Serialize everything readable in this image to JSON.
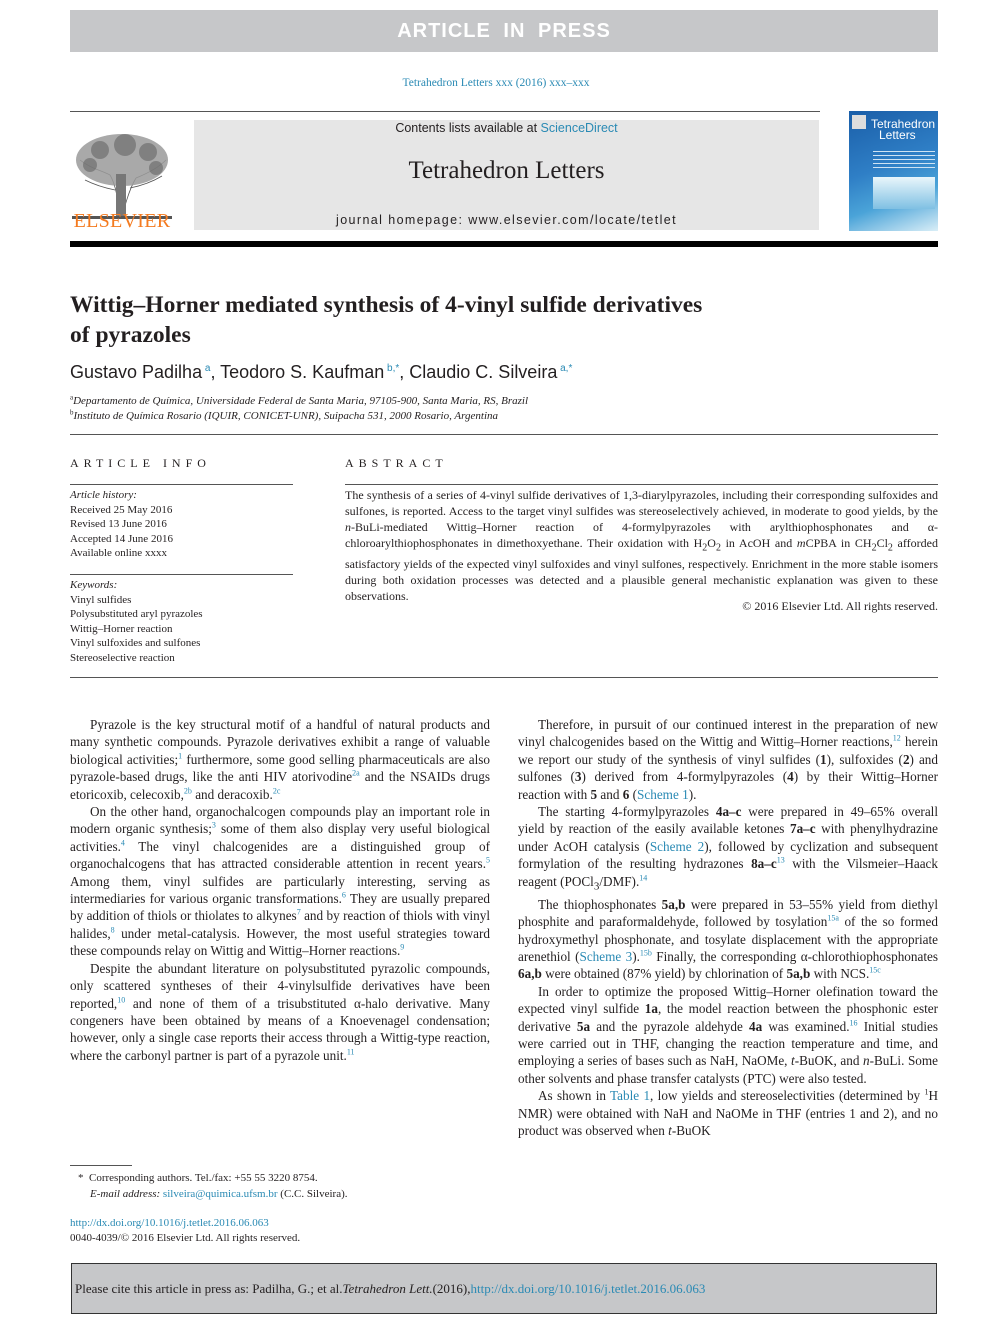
{
  "banner": {
    "label": "ARTICLE IN PRESS"
  },
  "citation_line": "Tetrahedron Letters xxx (2016) xxx–xxx",
  "header": {
    "publisher_logo_text": "ELSEVIER",
    "contents_prefix": "Contents lists available at ",
    "contents_link": "ScienceDirect",
    "journal_title": "Tetrahedron Letters",
    "homepage": "journal homepage: www.elsevier.com/locate/tetlet",
    "cover_title_1": "Tetrahedron",
    "cover_title_2": "Letters"
  },
  "article": {
    "title_line1": "Wittig–Horner mediated synthesis of 4-vinyl sulfide derivatives",
    "title_line2": "of pyrazoles",
    "authors": [
      {
        "name": "Gustavo Padilha",
        "sup": "a"
      },
      {
        "name": "Teodoro S. Kaufman",
        "sup": "b,*"
      },
      {
        "name": "Claudio C. Silveira",
        "sup": "a,*"
      }
    ],
    "affiliations": [
      {
        "mark": "a",
        "text": "Departamento de Química, Universidade Federal de Santa Maria, 97105-900, Santa Maria, RS, Brazil"
      },
      {
        "mark": "b",
        "text": "Instituto de Química Rosario (IQUIR, CONICET-UNR), Suipacha 531, 2000 Rosario, Argentina"
      }
    ]
  },
  "article_info": {
    "heading": "ARTICLE INFO",
    "history_label": "Article history:",
    "history": [
      "Received 25 May 2016",
      "Revised 13 June 2016",
      "Accepted 14 June 2016",
      "Available online xxxx"
    ],
    "keywords_label": "Keywords:",
    "keywords": [
      "Vinyl sulfides",
      "Polysubstituted aryl pyrazoles",
      "Wittig–Horner reaction",
      "Vinyl sulfoxides and sulfones",
      "Stereoselective reaction"
    ]
  },
  "abstract": {
    "heading": "ABSTRACT",
    "seg1": "The synthesis of a series of 4-vinyl sulfide derivatives of 1,3-diarylpyrazoles, including their corresponding sulfoxides and sulfones, is reported. Access to the target vinyl sulfides was stereoselectively achieved, in moderate to good yields, by the ",
    "seg_n": "n",
    "seg2": "-BuLi-mediated Wittig–Horner reaction of 4-formylpyrazoles with arylthiophosphonates and α-chloroarylthiophosphonates in dimethoxyethane. Their oxidation with H",
    "sub2": "2",
    "seg3": "O",
    "seg4": " in AcOH and ",
    "seg_m": "m",
    "seg5": "CPBA in CH",
    "seg6": "Cl",
    "seg7": " afforded satisfactory yields of the expected vinyl sulfoxides and vinyl sulfones, respectively. Enrichment in the more stable isomers during both oxidation processes was detected and a plausible general mechanistic explanation was given to these observations.",
    "copyright": "© 2016 Elsevier Ltd. All rights reserved."
  },
  "body_left": {
    "p1": [
      "Pyrazole is the key structural motif of a handful of natural products and many synthetic compounds. Pyrazole derivatives exhibit a range of valuable biological activities;",
      "1",
      " furthermore, some good selling pharmaceuticals are also pyrazole-based drugs, like the anti HIV atorivodine",
      "2a",
      " and the NSAIDs drugs etoricoxib, celecoxib,",
      "2b",
      " and deracoxib.",
      "2c"
    ],
    "p2": [
      "On the other hand, organochalcogen compounds play an important role in modern organic synthesis;",
      "3",
      " some of them also display very useful biological activities.",
      "4",
      " The vinyl chalcogenides are a distinguished group of organochalcogens that has attracted considerable attention in recent years.",
      "5",
      " Among them, vinyl sulfides are particularly interesting, serving as intermediaries for various organic transformations.",
      "6",
      " They are usually prepared by addition of thiols or thiolates to alkynes",
      "7",
      " and by reaction of thiols with vinyl halides,",
      "8",
      " under metal-catalysis. However, the most useful strategies toward these compounds relay on Wittig and Wittig–Horner reactions.",
      "9"
    ],
    "p3": [
      "Despite the abundant literature on polysubstituted pyrazolic compounds, only scattered syntheses of their 4-vinylsulfide derivatives have been reported,",
      "10",
      " and none of them of a trisubstituted α-halo derivative. Many congeners have been obtained by means of a Knoevenagel condensation; however, only a single case reports their access through a Wittig-type reaction, where the carbonyl partner is part of a pyrazole unit.",
      "11"
    ]
  },
  "body_right": {
    "p1": {
      "a": "Therefore, in pursuit of our continued interest in the preparation of new vinyl chalcogenides based on the Wittig and Wittig–Horner reactions,",
      "r12": "12",
      "b": " herein we report our study of the synthesis of vinyl sulfides (",
      "c1": "1",
      "c": "), sulfoxides (",
      "c2": "2",
      "d": ") and sulfones (",
      "c3": "3",
      "e": ") derived from 4-formylpyrazoles (",
      "c4": "4",
      "f": ") by their Wittig–Horner reaction with ",
      "c5": "5",
      "g": " and ",
      "c6": "6",
      "h": " (",
      "link": "Scheme 1",
      "i": ")."
    },
    "p2": {
      "a": "The starting 4-formylpyrazoles ",
      "b1": "4a–c",
      "b": " were prepared in 49–65% overall yield by reaction of the easily available ketones ",
      "b2": "7a–c",
      "c": " with phenylhydrazine under AcOH catalysis (",
      "link": "Scheme 2",
      "d": "), followed by cyclization and subsequent formylation of the resulting hydrazones ",
      "b3": "8a–c",
      "r13": "13",
      "e": " with the Vilsmeier–Haack reagent (POCl",
      "sub3": "3",
      "f": "/DMF).",
      "r14": "14"
    },
    "p3": {
      "a": "The thiophosphonates ",
      "b1": "5a,b",
      "b": " were prepared in 53–55% yield from diethyl phosphite and paraformaldehyde, followed by tosylation",
      "r15a": "15a",
      "c": " of the so formed hydroxymethyl phosphonate, and tosylate displacement with the appropriate arenethiol (",
      "link": "Scheme 3",
      "d": ").",
      "r15b": "15b",
      "e": " Finally, the corresponding α-chlorothiophosphonates ",
      "b2": "6a,b",
      "f": " were obtained (87% yield) by chlorination of ",
      "b3": "5a,b",
      "g": " with NCS.",
      "r15c": "15c"
    },
    "p4": {
      "a": "In order to optimize the proposed Wittig–Horner olefination toward the expected vinyl sulfide ",
      "b1": "1a",
      "b": ", the model reaction between the phosphonic ester derivative ",
      "b2": "5a",
      "c": " and the pyrazole aldehyde ",
      "b3": "4a",
      "d": " was examined.",
      "r16": "16",
      "e": " Initial studies were carried out in THF, changing the reaction temperature and time, and employing a series of bases such as NaH, NaOMe, ",
      "t": "t",
      "f": "-BuOK, and ",
      "n": "n",
      "g": "-BuLi. Some other solvents and phase transfer catalysts (PTC) were also tested."
    },
    "p5": {
      "a": "As shown in ",
      "link": "Table 1",
      "b": ", low yields and stereoselectivities (determined by ",
      "sup1": "1",
      "c": "H NMR) were obtained with NaH and NaOMe in THF (entries 1 and 2), and no product was observed when ",
      "t": "t",
      "d": "-BuOK"
    }
  },
  "footnote": {
    "star": "*",
    "text": "Corresponding authors. Tel./fax: +55 55 3220 8754.",
    "email_label": "E-mail address: ",
    "email": "silveira@quimica.ufsm.br",
    "email_owner": " (C.C. Silveira)."
  },
  "doi_block": {
    "doi": "http://dx.doi.org/10.1016/j.tetlet.2016.06.063",
    "issn": "0040-4039/© 2016 Elsevier Ltd. All rights reserved."
  },
  "cite_box": {
    "prefix": "Please cite this article in press as: Padilha, G.; et al. ",
    "journal": "Tetrahedron Lett.",
    "year": " (2016), ",
    "link": "http://dx.doi.org/10.1016/j.tetlet.2016.06.063"
  },
  "colors": {
    "link": "#2a8ab4",
    "elsevier_orange": "#f47b20",
    "banner_gray": "#c6c7c9",
    "header_box": "#e6e6e6"
  }
}
